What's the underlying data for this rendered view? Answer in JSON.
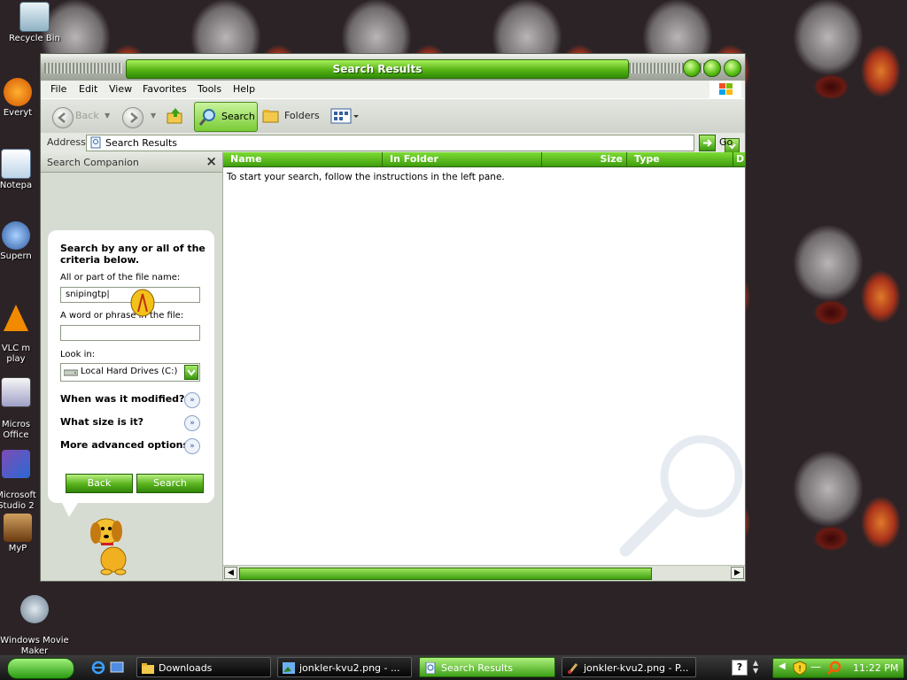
{
  "desktop": {
    "icons": [
      {
        "label": "Recycle Bin"
      },
      {
        "label": "Everyt"
      },
      {
        "label": "Notepa"
      },
      {
        "label": "Supern"
      },
      {
        "label": "VLC m\nplay"
      },
      {
        "label": "Micros\nOffice"
      },
      {
        "label": "Microsoft\nStudio 2"
      },
      {
        "label": "MyP"
      },
      {
        "label": "Windows Movie\nMaker"
      }
    ]
  },
  "window": {
    "title": "Search Results",
    "menu": [
      "File",
      "Edit",
      "View",
      "Favorites",
      "Tools",
      "Help"
    ],
    "toolbar": {
      "back_label": "Back",
      "search_label": "Search",
      "folders_label": "Folders"
    },
    "address": {
      "label": "Address",
      "value": "Search Results",
      "go_label": "Go"
    },
    "search_companion": {
      "title": "Search Companion",
      "close_glyph": "×",
      "heading": "Search by any or all of the criteria below.",
      "filename_label": "All or part of the file name:",
      "filename_value": "snipingtp|",
      "phrase_label": "A word or phrase in the file:",
      "phrase_value": "",
      "lookin_label": "Look in:",
      "lookin_value": "Local Hard Drives (C:)",
      "modified_label": "When was it modified?",
      "size_label": "What size is it?",
      "advanced_label": "More advanced options",
      "back_button": "Back",
      "search_button": "Search"
    },
    "results": {
      "columns": [
        "Name",
        "In Folder",
        "Size",
        "Type",
        "D"
      ],
      "message": "To start your search, follow the instructions in the left pane."
    }
  },
  "taskbar": {
    "tasks": [
      {
        "label": "Downloads",
        "active": false
      },
      {
        "label": "jonkler-kvu2.png - ...",
        "active": false
      },
      {
        "label": "Search Results",
        "active": true
      },
      {
        "label": "jonkler-kvu2.png - P...",
        "active": false
      }
    ],
    "clock": "11:22 PM"
  },
  "colors": {
    "accent_green": "#56b414",
    "dark_green": "#2f8a07",
    "pane_bg": "#d7dcd2"
  }
}
